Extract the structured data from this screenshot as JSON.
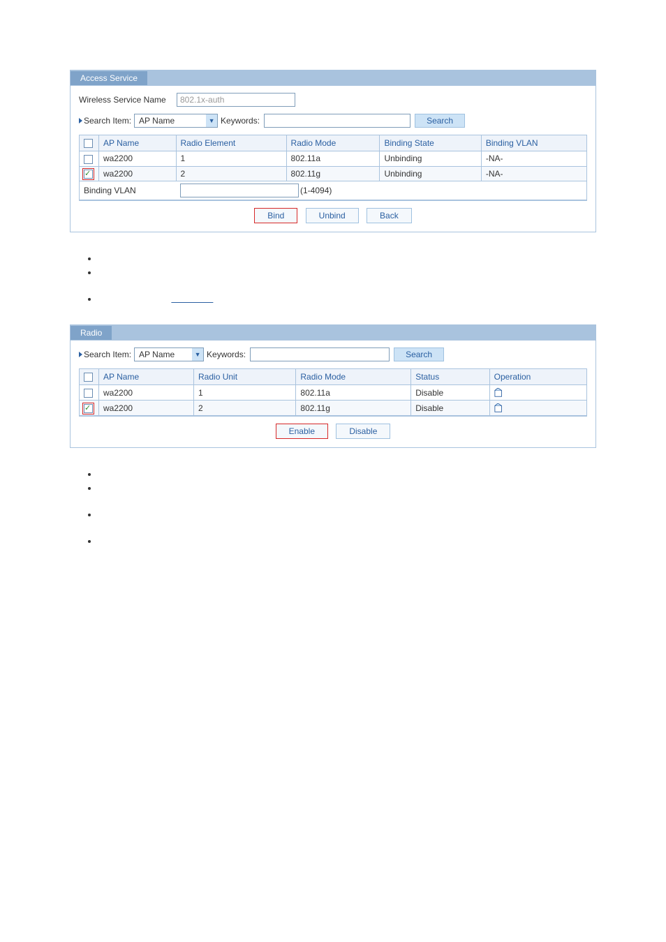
{
  "panel1": {
    "title": "Access Service",
    "service_name_label": "Wireless Service Name",
    "service_name_value": "802.1x-auth",
    "search": {
      "search_item_label": "Search Item:",
      "search_item_value": "AP Name",
      "keywords_label": "Keywords:",
      "keywords_value": "",
      "button": "Search"
    },
    "table": {
      "headers": [
        "",
        "AP Name",
        "Radio Element",
        "Radio Mode",
        "Binding State",
        "Binding VLAN"
      ],
      "rows": [
        {
          "checked": false,
          "ap": "wa2200",
          "radio_element": "1",
          "radio_mode": "802.11a",
          "binding_state": "Unbinding",
          "binding_vlan": "-NA-"
        },
        {
          "checked": true,
          "ap": "wa2200",
          "radio_element": "2",
          "radio_mode": "802.11g",
          "binding_state": "Unbinding",
          "binding_vlan": "-NA-"
        }
      ]
    },
    "binding": {
      "label": "Binding VLAN",
      "value": "",
      "hint": "(1-4094)"
    },
    "actions": {
      "bind": "Bind",
      "unbind": "Unbind",
      "back": "Back"
    }
  },
  "panel2": {
    "title": "Radio",
    "search": {
      "search_item_label": "Search Item:",
      "search_item_value": "AP Name",
      "keywords_label": "Keywords:",
      "keywords_value": "",
      "button": "Search"
    },
    "table": {
      "headers": [
        "",
        "AP Name",
        "Radio Unit",
        "Radio Mode",
        "Status",
        "Operation"
      ],
      "rows": [
        {
          "checked": false,
          "ap": "wa2200",
          "radio_unit": "1",
          "radio_mode": "802.11a",
          "status": "Disable"
        },
        {
          "checked": true,
          "ap": "wa2200",
          "radio_unit": "2",
          "radio_mode": "802.11g",
          "status": "Disable"
        }
      ]
    },
    "actions": {
      "enable": "Enable",
      "disable": "Disable"
    }
  },
  "bullets1": [
    "",
    "",
    ""
  ],
  "bullets2": [
    "",
    "",
    "",
    ""
  ]
}
